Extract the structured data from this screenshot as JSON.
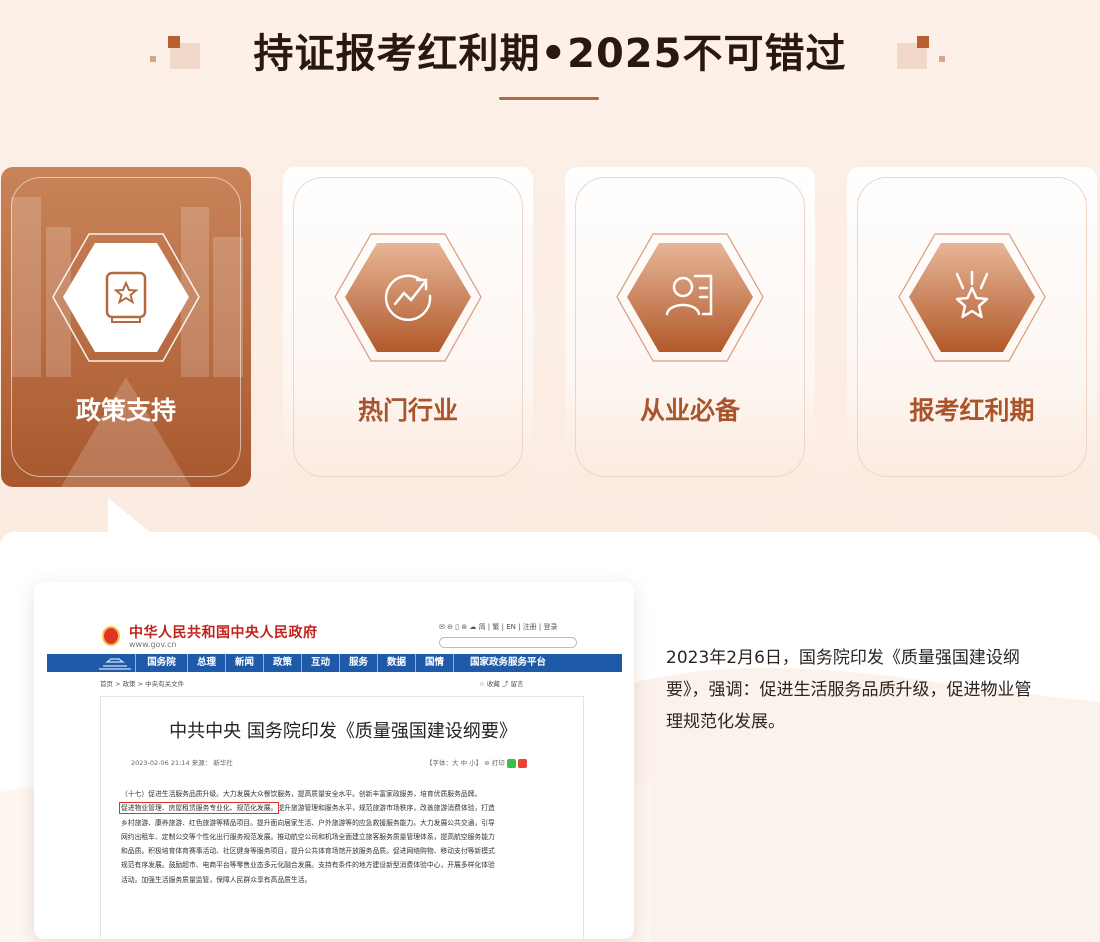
{
  "header": {
    "title": "持证报考红利期•2025不可错过"
  },
  "cards": [
    {
      "label": "政策支持",
      "icon": "star-certificate-icon",
      "active": true
    },
    {
      "label": "热门行业",
      "icon": "trend-arrow-icon",
      "active": false
    },
    {
      "label": "从业必备",
      "icon": "person-card-icon",
      "active": false
    },
    {
      "label": "报考红利期",
      "icon": "star-medal-icon",
      "active": false
    }
  ],
  "content": {
    "description": "2023年2月6日，国务院印发《质量强国建设纲要》，强调：促进生活服务品质升级，促进物业管理规范化发展。"
  },
  "gov_screenshot": {
    "site_name": "中华人民共和国中央人民政府",
    "url": "www.gov.cn",
    "tools": "✉ ⊖ ▯ ⊛ ☁ 简 | 繁 | EN | 注册 | 登录",
    "nav": [
      "国务院",
      "总理",
      "新闻",
      "政策",
      "互动",
      "服务",
      "数据",
      "国情",
      "国家政务服务平台"
    ],
    "breadcrumb": "首页 > 政策 > 中央有关文件",
    "breadcrumb_tools": "☆ 收藏   ⤴ 留言",
    "doc_title": "中共中央 国务院印发《质量强国建设纲要》",
    "doc_meta": "2023-02-06 21:14   来源： 新华社",
    "doc_meta_right": "【字体：大 中 小】   ⊜ 打印",
    "body_lines": [
      "（十七）促进生活服务品质升级。大力发展大众餐饮服务，提高质量安全水平。创新丰富家政服务，培育优质服务品牌。",
      "提升旅游管理和服务水平，规范旅游市场秩序，改善旅游消费体验，打造",
      "乡村旅游、康养旅游、红色旅游等精品项目。提升面向居家生活、户外旅游等的应急救援服务能力。大力发展公共交通，引导",
      "网约出租车、定制公交等个性化出行服务规范发展。推动航空公司和机场全面建立旅客服务质量管理体系，提高航空服务能力",
      "和品质。积极培育体育赛事活动、社区健身等服务项目，提升公共体育场馆开放服务品质。促进网络购物、移动支付等新模式",
      "规范有序发展。鼓励超市、电商平台等零售业态多元化融合发展。支持有条件的地方建设新型消费体验中心，开展多样化体验",
      "活动。加强生活服务质量监管，保障人民群众享有高品质生活。"
    ],
    "highlight": "促进物业管理、房屋租赁服务专业化、规范化发展。"
  },
  "colors": {
    "accent": "#b06a40",
    "label": "#a9542b",
    "gov_blue": "#1f5aa8",
    "gov_red": "#c0231b"
  }
}
